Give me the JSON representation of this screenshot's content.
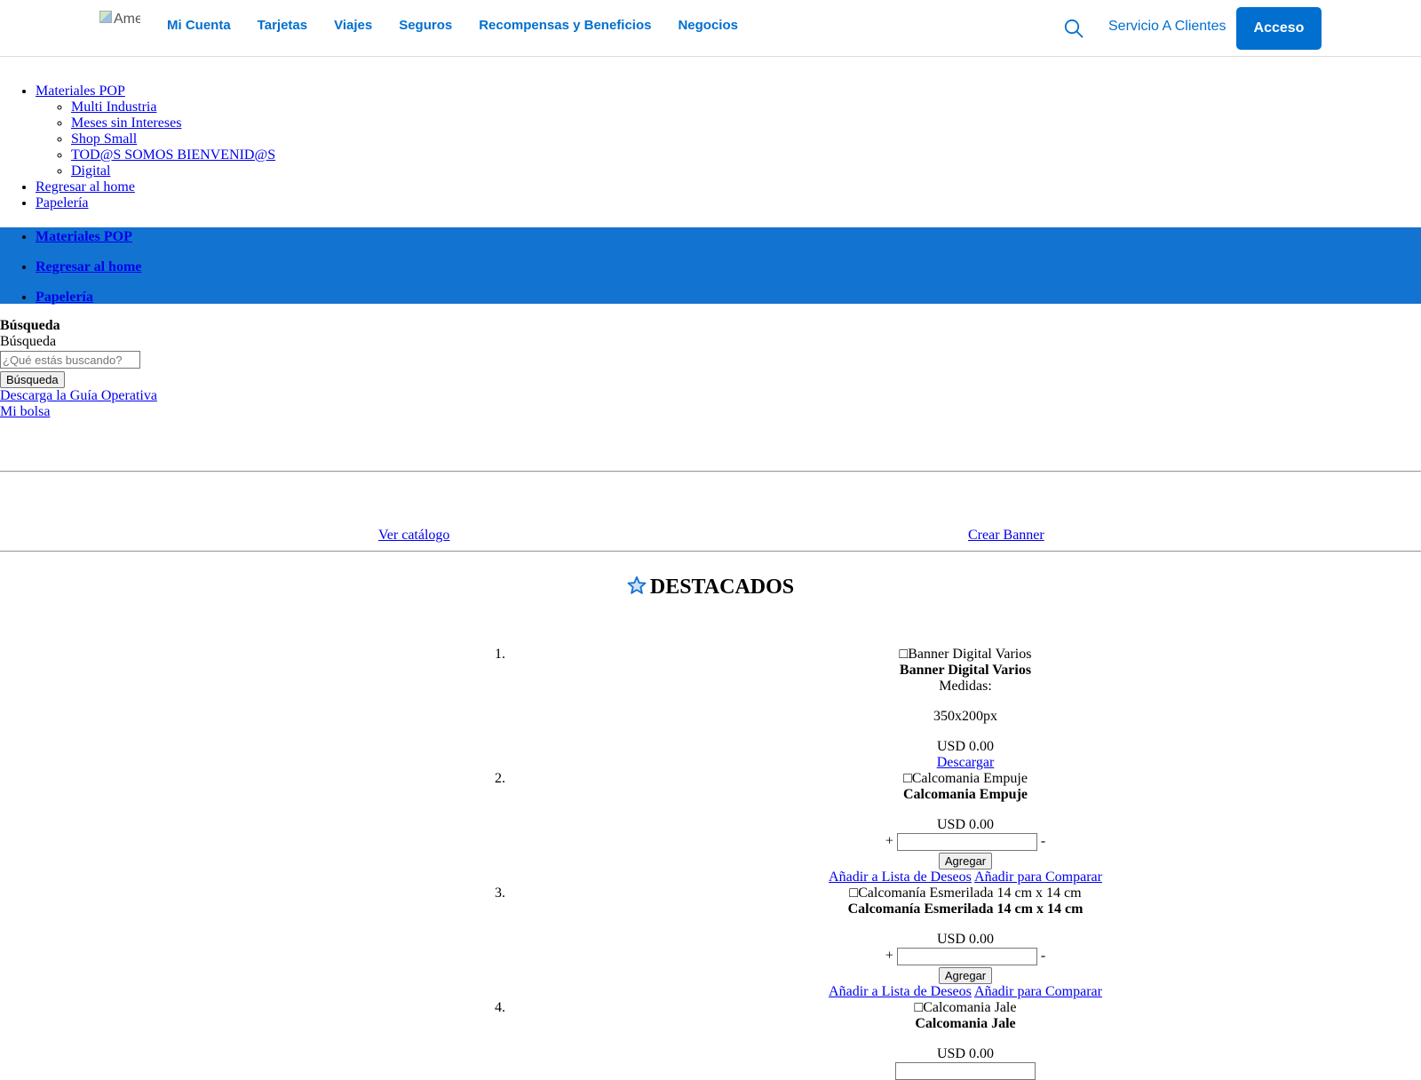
{
  "header": {
    "logo_alt": "American Express",
    "nav": [
      "Mi Cuenta",
      "Tarjetas",
      "Viajes",
      "Seguros",
      "Recompensas y Beneficios",
      "Negocios"
    ],
    "service_label": "Servicio A Clientes",
    "login_label": "Acceso"
  },
  "pop_menu": {
    "top": "Materiales POP",
    "sub": [
      "Multi Industria",
      "Meses sin Intereses",
      "Shop Small",
      "TOD@S SOMOS BIENVENID@S",
      "Digital"
    ],
    "home": "Regresar al home",
    "paper": "Papelería"
  },
  "bluebar": [
    "Materiales POP",
    "Regresar al home",
    "Papelería"
  ],
  "search": {
    "heading": "Búsqueda",
    "label": "Búsqueda",
    "placeholder": "¿Qué estás buscando?",
    "button": "Búsqueda"
  },
  "guide_link": "Descarga la Guía Operativa",
  "bag_link": "Mi bolsa",
  "catalog_link": "Ver catálogo",
  "banner_link": "Crear Banner",
  "featured_title": "DESTACADOS",
  "products": [
    {
      "num": "1.",
      "img_alt": "Banner Digital Varios",
      "name": "Banner Digital Varios",
      "measures_label": "Medidas:",
      "measures": "350x200px",
      "price": "USD 0.00",
      "download": "Descargar"
    },
    {
      "num": "2.",
      "img_alt": "Calcomania Empuje",
      "name": "Calcomania Empuje",
      "price": "USD 0.00",
      "plus": "+",
      "minus": "-",
      "add": "Agregar",
      "wish": "Añadir a Lista de Deseos",
      "compare": "Añadir para Comparar"
    },
    {
      "num": "3.",
      "img_alt": "Calcomanía Esmerilada 14 cm x 14 cm",
      "name": "Calcomanía Esmerilada 14 cm x 14 cm",
      "price": "USD 0.00",
      "plus": "+",
      "minus": "-",
      "add": "Agregar",
      "wish": "Añadir a Lista de Deseos",
      "compare": "Añadir para Comparar"
    },
    {
      "num": "4.",
      "img_alt": "Calcomania Jale",
      "name": "Calcomania Jale",
      "price": "USD 0.00"
    }
  ]
}
